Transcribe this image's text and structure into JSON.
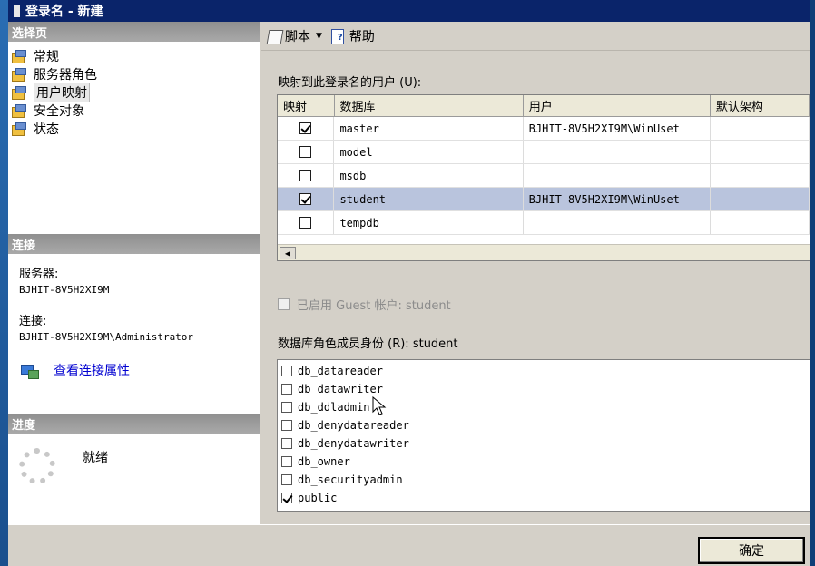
{
  "window": {
    "title": "登录名 - 新建"
  },
  "left": {
    "select_page_header": "选择页",
    "pages": [
      {
        "label": "常规",
        "selected": false
      },
      {
        "label": "服务器角色",
        "selected": false
      },
      {
        "label": "用户映射",
        "selected": true
      },
      {
        "label": "安全对象",
        "selected": false
      },
      {
        "label": "状态",
        "selected": false
      }
    ],
    "connection_header": "连接",
    "server_label": "服务器:",
    "server_value": "BJHIT-8V5H2XI9M",
    "connection_label": "连接:",
    "connection_value": "BJHIT-8V5H2XI9M\\Administrator",
    "view_props_link": "查看连接属性",
    "progress_header": "进度",
    "progress_status": "就绪"
  },
  "toolbar": {
    "script_label": "脚本",
    "help_label": "帮助"
  },
  "mapping": {
    "label": "映射到此登录名的用户 (U):",
    "columns": [
      "映射",
      "数据库",
      "用户",
      "默认架构"
    ],
    "rows": [
      {
        "mapped": true,
        "database": "master",
        "user": "BJHIT-8V5H2XI9M\\WinUset",
        "schema": "",
        "selected": false
      },
      {
        "mapped": false,
        "database": "model",
        "user": "",
        "schema": "",
        "selected": false
      },
      {
        "mapped": false,
        "database": "msdb",
        "user": "",
        "schema": "",
        "selected": false
      },
      {
        "mapped": true,
        "database": "student",
        "user": "BJHIT-8V5H2XI9M\\WinUset",
        "schema": "",
        "selected": true
      },
      {
        "mapped": false,
        "database": "tempdb",
        "user": "",
        "schema": "",
        "selected": false
      }
    ]
  },
  "guest": {
    "label": "已启用 Guest 帐户: student",
    "checked": false
  },
  "roles": {
    "label": "数据库角色成员身份 (R): student",
    "items": [
      {
        "name": "db_datareader",
        "checked": false
      },
      {
        "name": "db_datawriter",
        "checked": false
      },
      {
        "name": "db_ddladmin",
        "checked": false
      },
      {
        "name": "db_denydatareader",
        "checked": false
      },
      {
        "name": "db_denydatawriter",
        "checked": false
      },
      {
        "name": "db_owner",
        "checked": false
      },
      {
        "name": "db_securityadmin",
        "checked": false
      },
      {
        "name": "public",
        "checked": true
      }
    ]
  },
  "footer": {
    "ok_label": "确定"
  }
}
